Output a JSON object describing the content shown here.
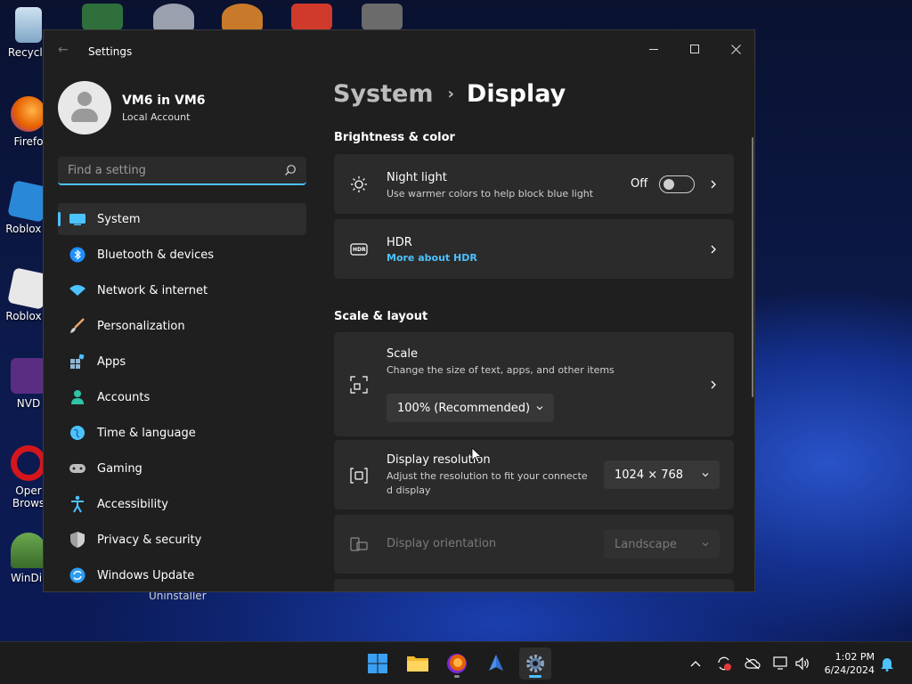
{
  "desktop": {
    "icons": [
      {
        "label": "Recycle",
        "color": "#8fb7d6"
      },
      {
        "label": "Firefo",
        "color": "#e66000"
      },
      {
        "label": "Roblox S",
        "color": "#2a88d8"
      },
      {
        "label": "Roblox P",
        "color": "#e8e8e8"
      },
      {
        "label": "NVD",
        "color": "#5a2d82"
      },
      {
        "label": "Oper Brows",
        "color": "#d4161c"
      },
      {
        "label": "WinDir",
        "color": "#5a8a3a"
      }
    ],
    "uninstaller_label": "Uninstaller"
  },
  "window": {
    "title": "Settings",
    "controls": {
      "minimize": "—",
      "maximize": "☐",
      "close": "✕"
    }
  },
  "account": {
    "name": "VM6 in VM6",
    "type": "Local Account"
  },
  "search": {
    "placeholder": "Find a setting"
  },
  "nav": {
    "items": [
      {
        "label": "System",
        "icon": "monitor-icon",
        "color": "#4cc2ff",
        "active": true
      },
      {
        "label": "Bluetooth & devices",
        "icon": "bluetooth-icon",
        "color": "#1f8fff"
      },
      {
        "label": "Network & internet",
        "icon": "wifi-icon",
        "color": "#4cc2ff"
      },
      {
        "label": "Personalization",
        "icon": "brush-icon",
        "color": "#e8a56b"
      },
      {
        "label": "Apps",
        "icon": "apps-icon",
        "color": "#8fb7d6"
      },
      {
        "label": "Accounts",
        "icon": "person-icon",
        "color": "#2ec4a5"
      },
      {
        "label": "Time & language",
        "icon": "globe-icon",
        "color": "#4cc2ff"
      },
      {
        "label": "Gaming",
        "icon": "gamepad-icon",
        "color": "#bdbdbd"
      },
      {
        "label": "Accessibility",
        "icon": "accessibility-icon",
        "color": "#4cc2ff"
      },
      {
        "label": "Privacy & security",
        "icon": "shield-icon",
        "color": "#a0a0a0"
      },
      {
        "label": "Windows Update",
        "icon": "update-icon",
        "color": "#2a9df4"
      }
    ]
  },
  "content": {
    "breadcrumb": {
      "parent": "System",
      "current": "Display"
    },
    "brightness_section": "Brightness & color",
    "night_light": {
      "title": "Night light",
      "subtitle": "Use warmer colors to help block blue light",
      "state": "Off"
    },
    "hdr": {
      "title": "HDR",
      "link": "More about HDR",
      "badge": "HDR"
    },
    "scale_section": "Scale & layout",
    "scale": {
      "title": "Scale",
      "subtitle": "Change the size of text, apps, and other items",
      "value": "100% (Recommended)"
    },
    "resolution": {
      "title": "Display resolution",
      "subtitle_line1": "Adjust the resolution to fit your connecte",
      "subtitle_line2": "d display",
      "value": "1024 × 768"
    },
    "orientation": {
      "title": "Display orientation",
      "value": "Landscape"
    }
  },
  "taskbar": {
    "apps": [
      "start-icon",
      "file-explorer-icon",
      "firefox-icon",
      "app-icon",
      "settings-icon"
    ],
    "clock": {
      "time": "1:02 PM",
      "date": "6/24/2024"
    }
  },
  "colors": {
    "accent": "#4cc2ff",
    "window_bg": "#1f1f1f",
    "card_bg": "#2b2b2b"
  }
}
